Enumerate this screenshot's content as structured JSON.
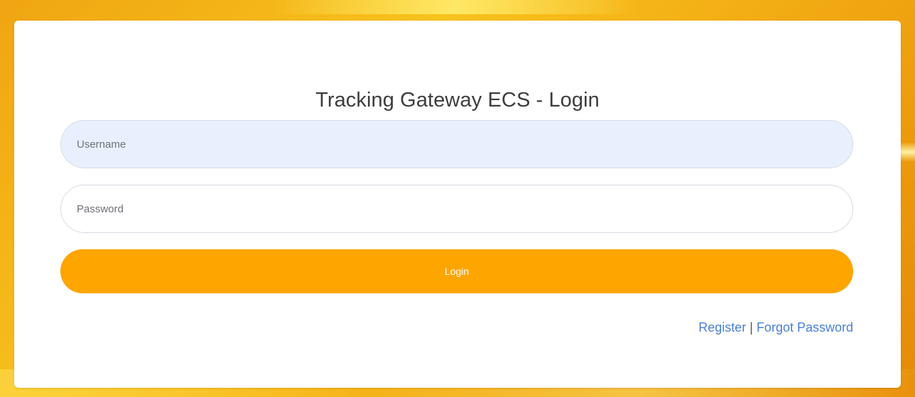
{
  "login": {
    "title": "Tracking Gateway ECS - Login",
    "username_placeholder": "Username",
    "password_placeholder": "Password",
    "button_label": "Login",
    "register_label": "Register",
    "separator": "|",
    "forgot_label": "Forgot Password"
  },
  "colors": {
    "accent": "#ffa500",
    "link": "#4a7fd6",
    "username_fill": "#e8f0fe"
  }
}
